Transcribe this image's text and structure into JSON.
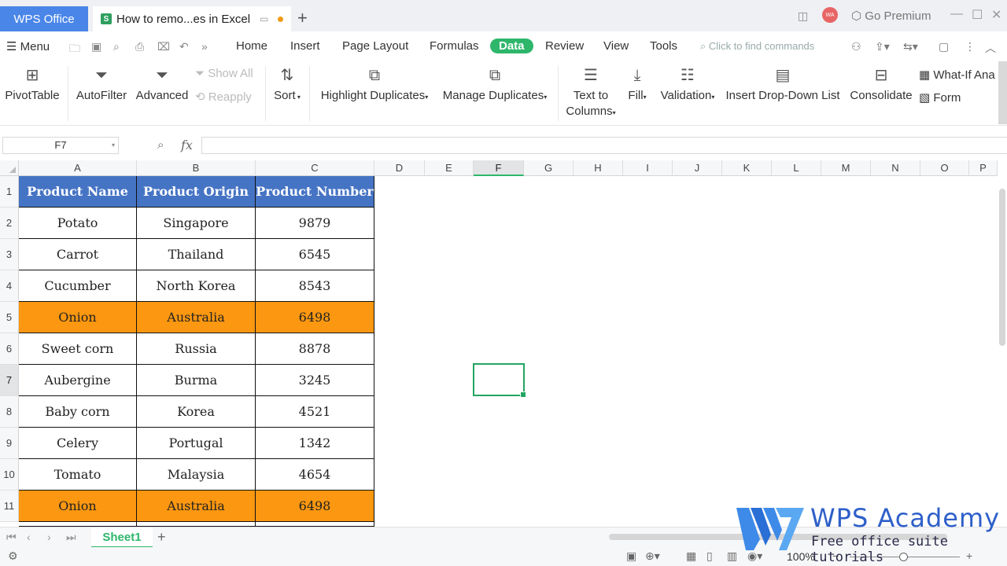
{
  "titlebar": {
    "app_tab": "WPS Office",
    "doc_tab": "How to remo...es in Excel",
    "avatar_initials": "WA",
    "premium": "Go Premium"
  },
  "menu": {
    "menu_label": "Menu",
    "tabs": [
      "Home",
      "Insert",
      "Page Layout",
      "Formulas",
      "Data",
      "Review",
      "View",
      "Tools"
    ],
    "active_tab": "Data",
    "find_placeholder": "Click to find commands"
  },
  "ribbon": {
    "pivot": "PivotTable",
    "autofilter": "AutoFilter",
    "advanced": "Advanced",
    "show_all": "Show All",
    "reapply": "Reapply",
    "sort": "Sort",
    "highlight_dup": "Highlight Duplicates",
    "manage_dup": "Manage Duplicates",
    "text_to_columns_1": "Text to",
    "text_to_columns_2": "Columns",
    "fill": "Fill",
    "validation": "Validation",
    "dropdown_list": "Insert Drop-Down List",
    "consolidate": "Consolidate",
    "what_if": "What-If Ana",
    "form": "Form"
  },
  "formula_bar": {
    "name_box": "F7",
    "fx": "fx",
    "value": ""
  },
  "grid": {
    "columns": [
      "A",
      "B",
      "C",
      "D",
      "E",
      "F",
      "G",
      "H",
      "I",
      "J",
      "K",
      "L",
      "M",
      "N",
      "O",
      "P"
    ],
    "rows": [
      "1",
      "2",
      "3",
      "4",
      "5",
      "6",
      "7",
      "8",
      "9",
      "10",
      "11"
    ],
    "selected_cell": "F7",
    "header": [
      "Product Name",
      "Product Origin",
      "Product Number"
    ],
    "data": [
      [
        "Potato",
        "Singapore",
        "9879"
      ],
      [
        "Carrot",
        "Thailand",
        "6545"
      ],
      [
        "Cucumber",
        "North Korea",
        "8543"
      ],
      [
        "Onion",
        "Australia",
        "6498"
      ],
      [
        "Sweet corn",
        "Russia",
        "8878"
      ],
      [
        "Aubergine",
        "Burma",
        "3245"
      ],
      [
        "Baby corn",
        "Korea",
        "4521"
      ],
      [
        "Celery",
        "Portugal",
        "1342"
      ],
      [
        "Tomato",
        "Malaysia",
        "4654"
      ],
      [
        "Onion",
        "Australia",
        "6498"
      ]
    ],
    "highlight_color": "#fb9710",
    "header_color": "#4674c4"
  },
  "sheets": {
    "active": "Sheet1"
  },
  "status": {
    "zoom": "100%"
  },
  "watermark": {
    "title": "WPS Academy",
    "subtitle": "Free office suite tutorials"
  }
}
